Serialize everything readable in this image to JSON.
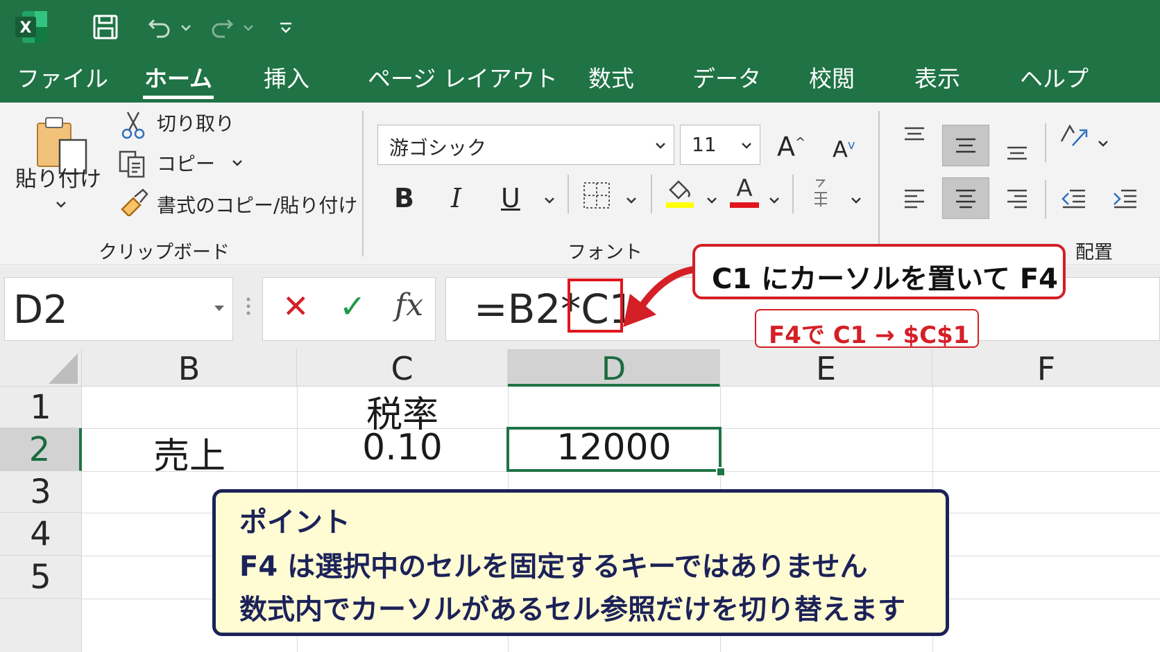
{
  "colors": {
    "excel_green": "#1f7345",
    "ribbon_bg": "#f3f3f3",
    "callout_red": "#d41f26",
    "point_bg": "#fffbd3",
    "point_border": "#1c2258",
    "font_color_bar": "#e0161d",
    "highlight_bar": "#ffff00"
  },
  "titlebar": {
    "app_icon": "excel-icon",
    "app_letter": "X",
    "quick_access": [
      "save-icon",
      "undo-icon",
      "redo-icon",
      "customize-icon"
    ]
  },
  "menu": {
    "tabs": [
      {
        "label": "ファイル"
      },
      {
        "label": "ホーム"
      },
      {
        "label": "挿入"
      },
      {
        "label": "ページ レイアウト"
      },
      {
        "label": "数式"
      },
      {
        "label": "データ"
      },
      {
        "label": "校閲"
      },
      {
        "label": "表示"
      },
      {
        "label": "ヘルプ"
      }
    ],
    "active_index": 1
  },
  "ribbon": {
    "clipboard": {
      "paste_label": "貼り付け",
      "cut_label": "切り取り",
      "copy_label": "コピー",
      "format_painter_label": "書式のコピー/貼り付け",
      "group_label": "クリップボード"
    },
    "font": {
      "font_name": "游ゴシック",
      "font_size": "11",
      "bold": "B",
      "italic": "I",
      "underline": "U",
      "grow": "A",
      "shrink": "A",
      "font_color_letter": "A",
      "group_label": "フォント"
    },
    "alignment": {
      "group_label": "配置"
    }
  },
  "formula_bar": {
    "name_box": "D2",
    "cancel": "✕",
    "enter": "✓",
    "fx": "fx",
    "formula_prefix": "=B2*",
    "formula_ref": "C1"
  },
  "sheet": {
    "columns": [
      "B",
      "C",
      "D",
      "E",
      "F"
    ],
    "selected_column": "D",
    "rows": [
      "1",
      "2",
      "3",
      "4",
      "5"
    ],
    "selected_row": "2",
    "cells": {
      "C1": "税率",
      "B2": "売上",
      "C2": "0.10",
      "D2": "12000"
    }
  },
  "callouts": {
    "main": "C1 にカーソルを置いて F4",
    "sub": "F4で C1 → $C$1",
    "point": {
      "title": "ポイント",
      "line1": "F4 は選択中のセルを固定するキーではありません",
      "line2": "数式内でカーソルがあるセル参照だけを切り替えます"
    }
  }
}
